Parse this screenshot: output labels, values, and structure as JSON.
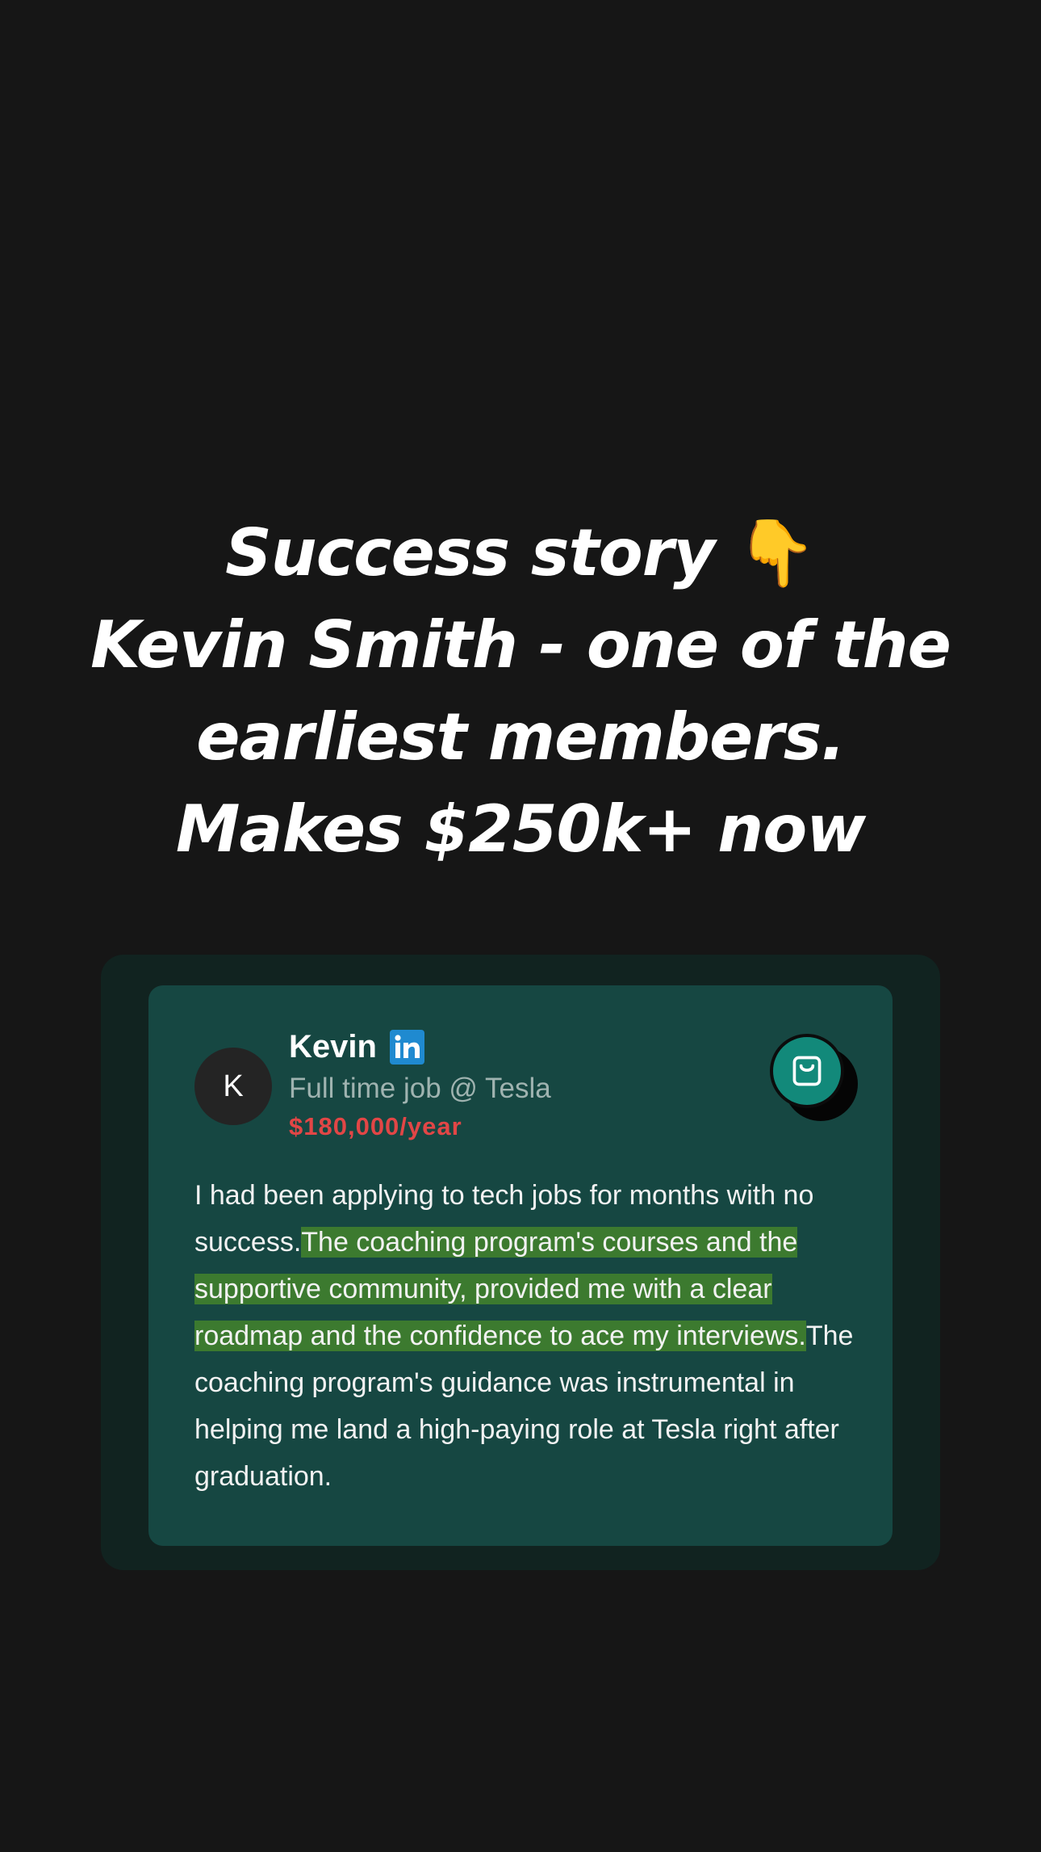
{
  "headline": {
    "line1": "Success story",
    "emoji": "👇",
    "line2": "Kevin Smith - one of the",
    "line3": "earliest members.",
    "line4": "Makes $250k+ now"
  },
  "card": {
    "avatar_initial": "K",
    "name": "Kevin",
    "job": "Full time job @ Tesla",
    "salary": "$180,000/year",
    "icons": {
      "linkedin": "linkedin-icon",
      "action": "shopping-bag-icon"
    },
    "testimonial": {
      "before": "I had been applying to tech jobs for months with no success.",
      "highlight": "The coaching program's courses and the supportive community, provided me with a clear roadmap and the confidence to ace my interviews.",
      "after": "The coaching program's guidance was instrumental in helping me land a high-paying role at Tesla right after graduation."
    }
  },
  "colors": {
    "background": "#161616",
    "card_outer": "#112320",
    "card_inner": "#164742",
    "highlight": "#3c7a2f",
    "salary": "#e24646",
    "action_button": "#12897a",
    "linkedin": "#1f8ad0"
  }
}
